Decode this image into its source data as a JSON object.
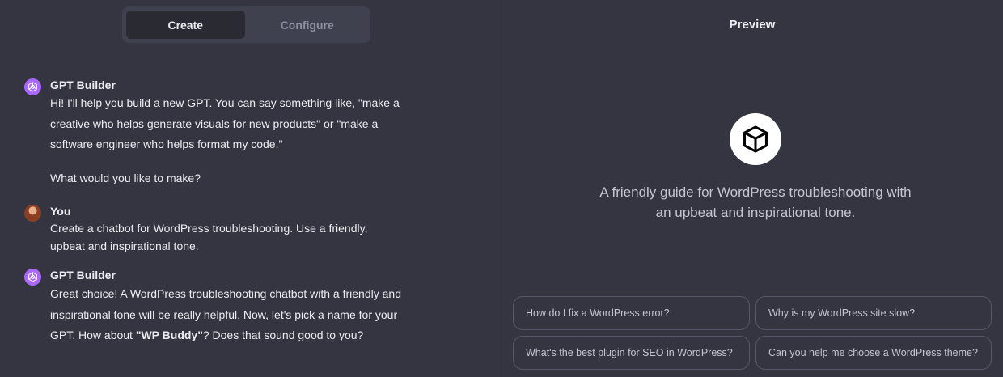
{
  "tabs": {
    "create": "Create",
    "configure": "Configure"
  },
  "messages": [
    {
      "sender": "GPT Builder",
      "paragraphs": [
        "Hi! I'll help you build a new GPT. You can say something like, \"make a creative who helps generate visuals for new products\" or \"make a software engineer who helps format my code.\"",
        "What would you like to make?"
      ]
    },
    {
      "sender": "You",
      "text": "Create a chatbot for WordPress troubleshooting. Use a friendly, upbeat and inspirational tone."
    },
    {
      "sender": "GPT Builder",
      "text_before": "Great choice! A WordPress troubleshooting chatbot with a friendly and inspirational tone will be really helpful. Now, let's pick a name for your GPT. How about ",
      "text_bold": "\"WP Buddy\"",
      "text_after": "? Does that sound good to you?"
    }
  ],
  "preview": {
    "title": "Preview",
    "description": "A friendly guide for WordPress troubleshooting with an upbeat and inspirational tone.",
    "starters": [
      "How do I fix a WordPress error?",
      "Why is my WordPress site slow?",
      "What's the best plugin for SEO in WordPress?",
      "Can you help me choose a WordPress theme?"
    ]
  },
  "colors": {
    "background": "#343541",
    "gpt_avatar": "#ab68ff",
    "text": "#ececf1",
    "muted_text": "#8e8ea0"
  },
  "icons": {
    "gpt_builder_avatar": "openai-logo-icon",
    "gpt_preview": "cube-icon"
  }
}
